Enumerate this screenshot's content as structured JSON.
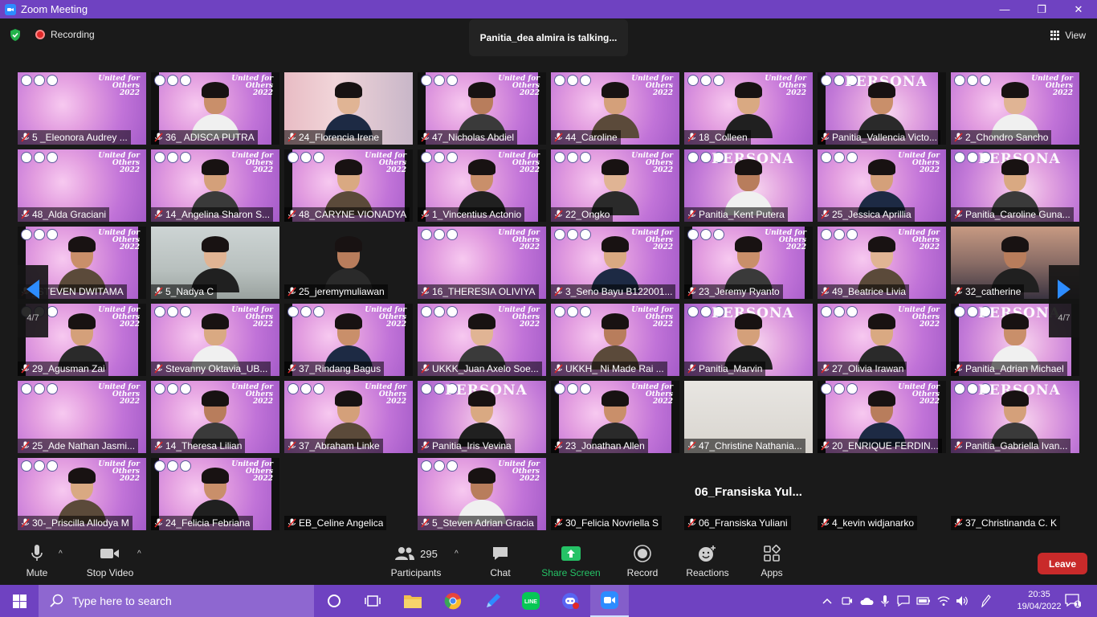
{
  "window": {
    "title": "Zoom Meeting",
    "controls": [
      "—",
      "❐",
      "✕"
    ]
  },
  "topbar": {
    "recording_label": "Recording",
    "talking": "Panitia_dea almira is talking...",
    "view_label": "View"
  },
  "pagination": {
    "left": "4/7",
    "right": "4/7"
  },
  "grid": {
    "big_names": {
      "06_Fransiska Yuliani": "06_Fransiska  Yul..."
    },
    "tiles": [
      {
        "name": "5 _Eleonora Audrey ...",
        "bg": "vbg",
        "person": false
      },
      {
        "name": "36_ ADISCA PUTRA",
        "bg": "vbg",
        "person": true
      },
      {
        "name": "24_Florencia Irene",
        "bg": "pink",
        "person": true
      },
      {
        "name": "47_Nicholas Abdiel",
        "bg": "vbg",
        "person": true
      },
      {
        "name": "44_Caroline",
        "bg": "vbg",
        "person": true
      },
      {
        "name": "18_Colleen",
        "bg": "vbg",
        "person": true
      },
      {
        "name": "Panitia_Vallencia Victo...",
        "bg": "persona",
        "person": true
      },
      {
        "name": "2_Chondro Sancho",
        "bg": "vbg",
        "person": true
      },
      {
        "name": "48_Alda Graciani",
        "bg": "vbg",
        "person": false
      },
      {
        "name": "14_Angelina Sharon S...",
        "bg": "vbg",
        "person": true
      },
      {
        "name": "48_CARYNE VIONADYA",
        "bg": "vbg",
        "person": true
      },
      {
        "name": "1_Vincentius Actonio",
        "bg": "vbg",
        "person": true
      },
      {
        "name": "22_Ongko",
        "bg": "vbg",
        "person": true
      },
      {
        "name": "Panitia_Kent Putera",
        "bg": "persona",
        "person": true
      },
      {
        "name": "25_Jessica Aprillia",
        "bg": "vbg",
        "person": true
      },
      {
        "name": "Panitia_Caroline Guna...",
        "bg": "persona",
        "person": true
      },
      {
        "name": "_STEVEN DWITAMA",
        "bg": "vbg",
        "person": true
      },
      {
        "name": "5_Nadya C",
        "bg": "room",
        "person": true
      },
      {
        "name": "25_jeremymuliawan",
        "bg": "dark",
        "person": true
      },
      {
        "name": "16_THERESIA OLIVIYA",
        "bg": "vbg",
        "person": false
      },
      {
        "name": "3_Seno Bayu B122001...",
        "bg": "vbg",
        "person": true
      },
      {
        "name": "23_Jeremy Ryanto",
        "bg": "vbg",
        "person": true
      },
      {
        "name": "49_Beatrice Livia",
        "bg": "vbg",
        "person": true
      },
      {
        "name": "32_catherine",
        "bg": "sky",
        "person": true
      },
      {
        "name": "29_Agusman Zai",
        "bg": "vbg",
        "person": true
      },
      {
        "name": "Stevanny Oktavia_UB...",
        "bg": "vbg",
        "person": true
      },
      {
        "name": "37_Rindang Bagus",
        "bg": "vbg",
        "person": true
      },
      {
        "name": "UKKK_Juan Axelo Soe...",
        "bg": "vbg",
        "person": true
      },
      {
        "name": "UKKH_ Ni Made Rai ...",
        "bg": "vbg",
        "person": true
      },
      {
        "name": "Panitia_Marvin",
        "bg": "persona",
        "person": true
      },
      {
        "name": "27_Olivia Irawan",
        "bg": "vbg",
        "person": true
      },
      {
        "name": "Panitia_Adrian Michael",
        "bg": "persona",
        "person": true
      },
      {
        "name": "25_Ade Nathan Jasmi...",
        "bg": "vbg",
        "person": false
      },
      {
        "name": "14_Theresa Lilian",
        "bg": "vbg",
        "person": true
      },
      {
        "name": "37_Abraham Linke",
        "bg": "vbg",
        "person": true
      },
      {
        "name": "Panitia_Iris Vevina",
        "bg": "persona",
        "person": true
      },
      {
        "name": "23_Jonathan Allen",
        "bg": "vbg",
        "person": true
      },
      {
        "name": "47_Christine Nathania...",
        "bg": "gray",
        "person": false
      },
      {
        "name": "20_ENRIQUE FERDIN...",
        "bg": "vbg",
        "person": true
      },
      {
        "name": "Panitia_Gabriella Ivan...",
        "bg": "persona",
        "person": true
      },
      {
        "name": "30-_Priscilla Allodya M",
        "bg": "vbg",
        "person": true
      },
      {
        "name": "24_Felicia Febriana",
        "bg": "vbg",
        "person": true
      },
      {
        "name": "EB_Celine Angelica",
        "bg": "dark",
        "person": false
      },
      {
        "name": "5_Steven Adrian Gracia",
        "bg": "vbg",
        "person": true
      },
      {
        "name": "30_Felicia Novriella S",
        "bg": "dark",
        "person": false
      },
      {
        "name": "06_Fransiska Yuliani",
        "bg": "dark",
        "person": false
      },
      {
        "name": "4_kevin widjanarko",
        "bg": "dark",
        "person": false
      },
      {
        "name": "37_Christinanda C. K",
        "bg": "dark",
        "person": false
      }
    ],
    "banner_text": "United for Others 2022",
    "persona_text": "PERSONA"
  },
  "toolbar": {
    "mute": "Mute",
    "stop_video": "Stop Video",
    "participants": "Participants",
    "participant_count": "295",
    "chat": "Chat",
    "share_screen": "Share Screen",
    "record": "Record",
    "reactions": "Reactions",
    "apps": "Apps",
    "leave": "Leave"
  },
  "taskbar": {
    "search_placeholder": "Type here to search",
    "time": "20:35",
    "date": "19/04/2022",
    "notification_count": "1"
  },
  "colors": {
    "accent": "#6f42c1",
    "zoom_blue": "#2d8cff",
    "share_green": "#25c266",
    "leave_red": "#c92a2a"
  }
}
